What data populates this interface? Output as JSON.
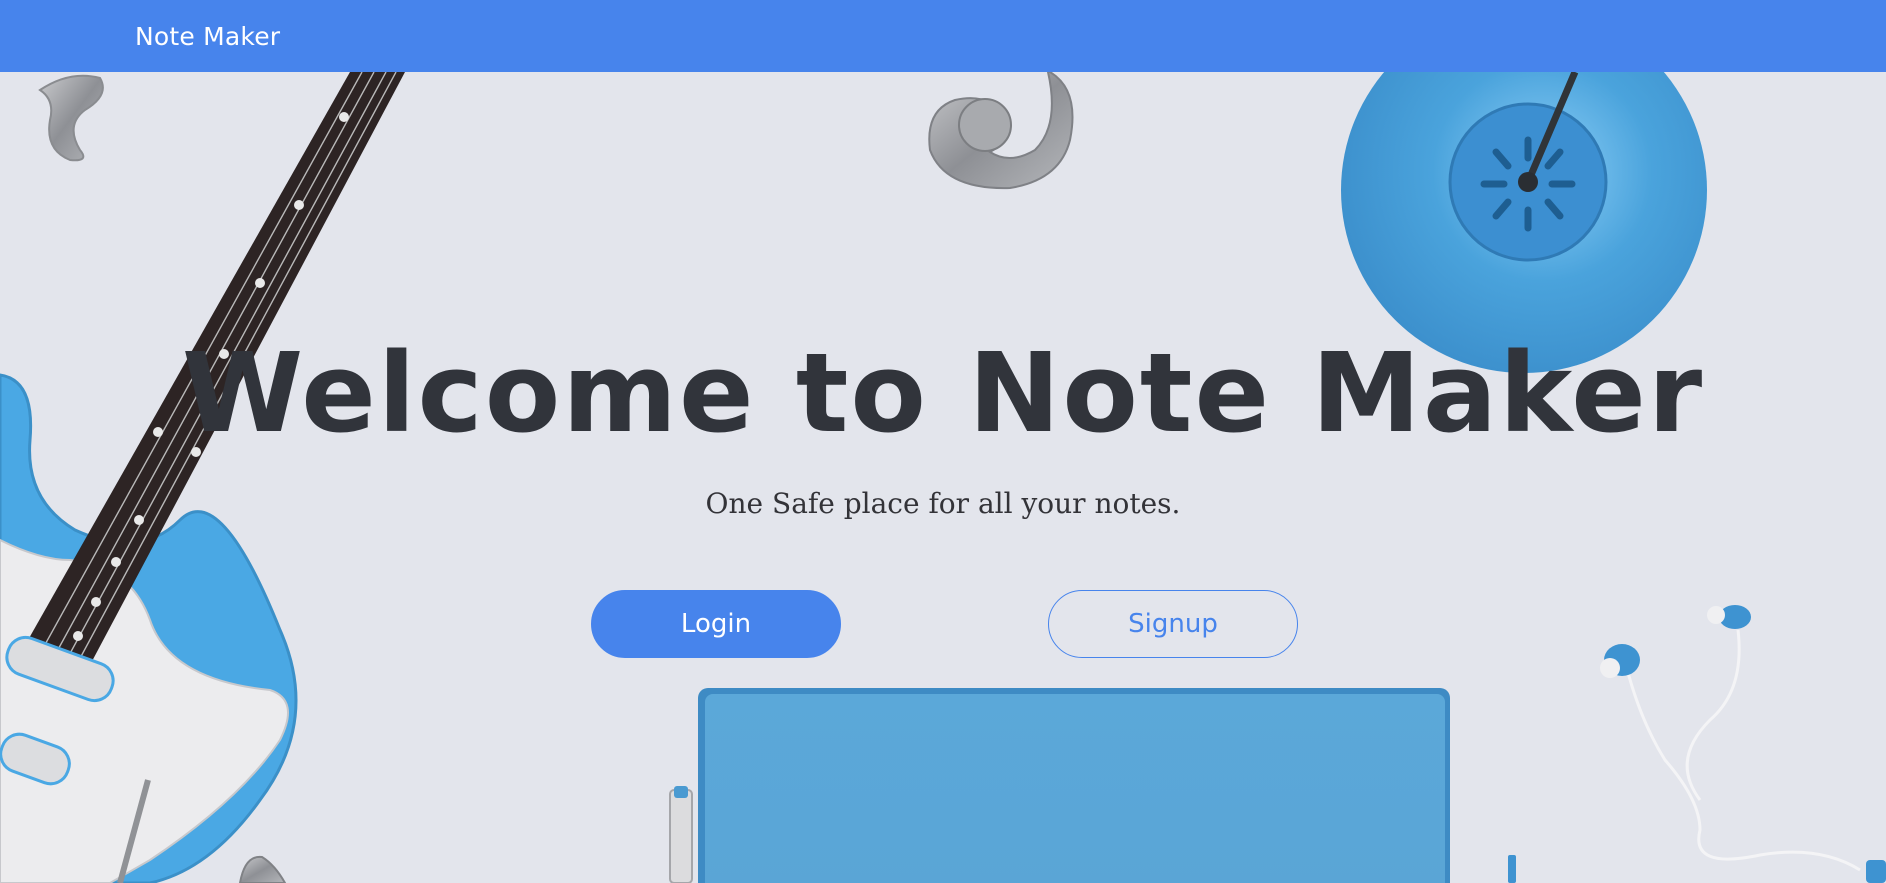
{
  "navbar": {
    "brand": "Note Maker",
    "color": "#4784ec"
  },
  "hero": {
    "title": "Welcome to Note Maker",
    "subtitle": "One Safe place for all your notes.",
    "login_label": "Login",
    "signup_label": "Signup",
    "accent_color": "#4784ec"
  },
  "background": {
    "icons": [
      "guitar-icon",
      "lamp-icon",
      "earphones-icon",
      "notebook-icon",
      "pen-icon",
      "metal-swirl-icon"
    ]
  }
}
